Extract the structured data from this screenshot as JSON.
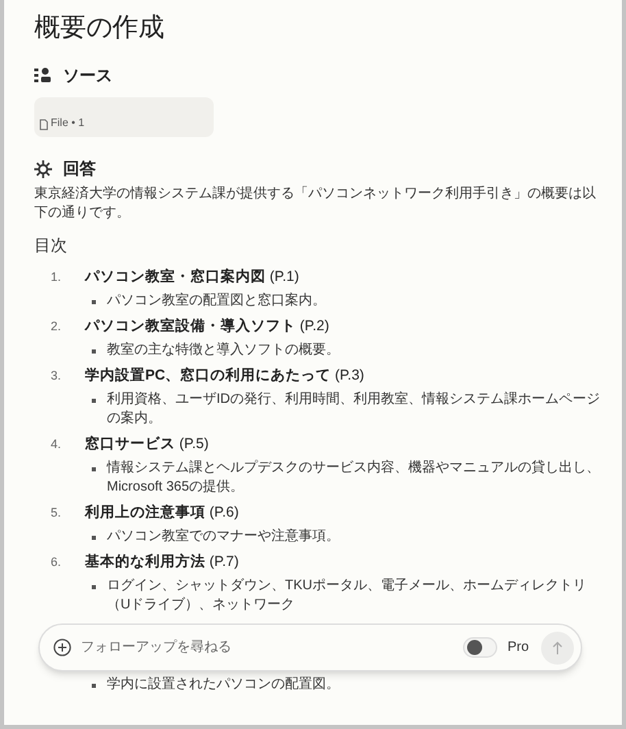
{
  "title": "概要の作成",
  "sources": {
    "heading": "ソース",
    "file_label": "File • 1"
  },
  "answer": {
    "heading": "回答",
    "intro": "東京経済大学の情報システム課が提供する「パソコンネットワーク利用手引き」の概要は以下の通りです。"
  },
  "toc": {
    "heading": "目次",
    "items": [
      {
        "number": "1.",
        "title": "パソコン教室・窓口案内図",
        "page": "(P.1)",
        "bullets": [
          "パソコン教室の配置図と窓口案内。"
        ]
      },
      {
        "number": "2.",
        "title": "パソコン教室設備・導入ソフト",
        "page": "(P.2)",
        "bullets": [
          "教室の主な特徴と導入ソフトの概要。"
        ]
      },
      {
        "number": "3.",
        "title": "学内設置PC、窓口の利用にあたって",
        "page": "(P.3)",
        "bullets": [
          "利用資格、ユーザIDの発行、利用時間、利用教室、情報システム課ホームページの案内。"
        ]
      },
      {
        "number": "4.",
        "title": "窓口サービス",
        "page": "(P.5)",
        "bullets": [
          "情報システム課とヘルプデスクのサービス内容、機器やマニュアルの貸し出し、Microsoft 365の提供。"
        ]
      },
      {
        "number": "5.",
        "title": "利用上の注意事項",
        "page": "(P.6)",
        "bullets": [
          "パソコン教室でのマナーや注意事項。"
        ]
      },
      {
        "number": "6.",
        "title": "基本的な利用方法",
        "page": "(P.7)",
        "bullets": [
          "ログイン、シャットダウン、TKUポータル、電子メール、ホームディレクトリ（Uドライブ）、ネットワーク"
        ]
      }
    ],
    "trailing_bullets": [
      "学内に設置されたパソコンの配置図。"
    ]
  },
  "followup": {
    "placeholder": "フォローアップを尋ねる",
    "pro_label": "Pro",
    "pro_on": false
  }
}
